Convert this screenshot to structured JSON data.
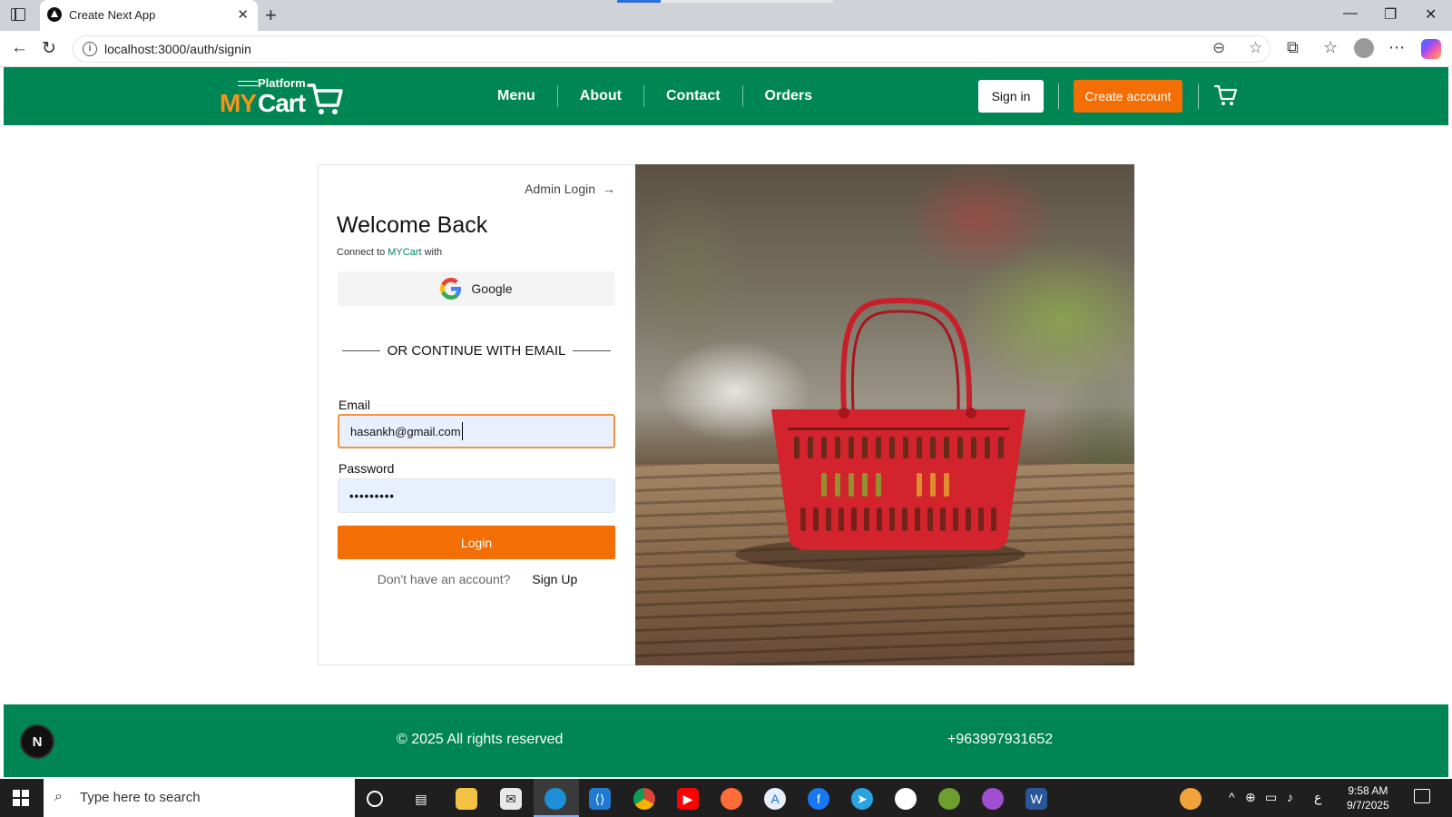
{
  "browser": {
    "tab_title": "Create Next App",
    "url": "localhost:3000/auth/signin"
  },
  "header": {
    "logo_platform": "Platform",
    "logo_my": "MY",
    "logo_cart": "Cart",
    "nav": [
      "Menu",
      "About",
      "Contact",
      "Orders"
    ],
    "signin_label": "Sign in",
    "create_account_label": "Create account"
  },
  "login": {
    "admin_link": "Admin Login",
    "title": "Welcome Back",
    "connect_prefix": "Connect to ",
    "connect_brand": "MYCart",
    "connect_suffix": " with",
    "google_label": "Google",
    "divider_text": "OR CONTINUE WITH EMAIL",
    "email_label": "Email",
    "email_value": "hasankh@gmail.com",
    "password_label": "Password",
    "password_value": "•••••••••",
    "login_button": "Login",
    "signup_question": "Don't have an account?",
    "signup_link": "Sign Up"
  },
  "footer": {
    "badge": "N",
    "copyright": "© 2025 All rights reserved",
    "phone": "+963997931652"
  },
  "taskbar": {
    "search_placeholder": "Type here to search",
    "time": "9:58 AM",
    "date": "9/7/2025",
    "lang": "ع"
  },
  "colors": {
    "brand_green": "#008554",
    "brand_orange": "#f36f05"
  }
}
